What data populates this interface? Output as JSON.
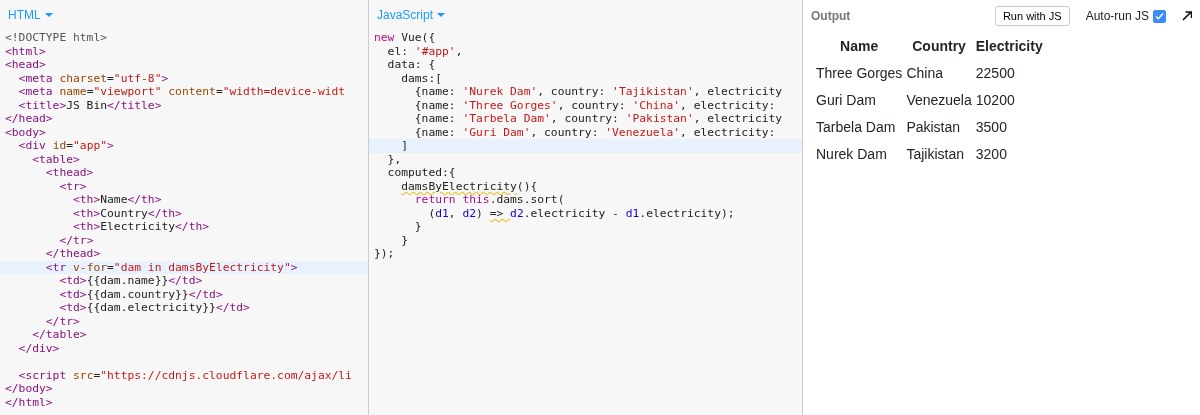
{
  "panels": [
    {
      "title": "HTML",
      "lines": [
        {
          "active": false,
          "tokens": [
            {
              "kind": "meta",
              "text": "<!DOCTYPE html>"
            }
          ]
        },
        {
          "active": false,
          "tokens": [
            {
              "kind": "tag",
              "text": "<html>"
            }
          ]
        },
        {
          "active": false,
          "tokens": [
            {
              "kind": "tag",
              "text": "<head>"
            }
          ]
        },
        {
          "active": false,
          "tokens": [
            {
              "kind": "tag",
              "text": "  <meta "
            },
            {
              "kind": "attr",
              "text": "charset"
            },
            {
              "kind": "plain",
              "text": "="
            },
            {
              "kind": "string",
              "text": "\"utf-8\""
            },
            {
              "kind": "tag",
              "text": ">"
            }
          ]
        },
        {
          "active": false,
          "tokens": [
            {
              "kind": "tag",
              "text": "  <meta "
            },
            {
              "kind": "attr",
              "text": "name"
            },
            {
              "kind": "plain",
              "text": "="
            },
            {
              "kind": "string",
              "text": "\"viewport\" "
            },
            {
              "kind": "attr",
              "text": "content"
            },
            {
              "kind": "plain",
              "text": "="
            },
            {
              "kind": "string",
              "text": "\"width=device-widt"
            }
          ]
        },
        {
          "active": false,
          "tokens": [
            {
              "kind": "tag",
              "text": "  <title>"
            },
            {
              "kind": "plain",
              "text": "JS Bin"
            },
            {
              "kind": "tag",
              "text": "</title>"
            }
          ]
        },
        {
          "active": false,
          "tokens": [
            {
              "kind": "tag",
              "text": "</head>"
            }
          ]
        },
        {
          "active": false,
          "tokens": [
            {
              "kind": "tag",
              "text": "<body>"
            }
          ]
        },
        {
          "active": false,
          "tokens": [
            {
              "kind": "tag",
              "text": "  <div "
            },
            {
              "kind": "attr",
              "text": "id"
            },
            {
              "kind": "plain",
              "text": "="
            },
            {
              "kind": "string",
              "text": "\"app\""
            },
            {
              "kind": "tag",
              "text": ">"
            }
          ]
        },
        {
          "active": false,
          "tokens": [
            {
              "kind": "tag",
              "text": "    <table>"
            }
          ]
        },
        {
          "active": false,
          "tokens": [
            {
              "kind": "tag",
              "text": "      <thead>"
            }
          ]
        },
        {
          "active": false,
          "tokens": [
            {
              "kind": "tag",
              "text": "        <tr>"
            }
          ]
        },
        {
          "active": false,
          "tokens": [
            {
              "kind": "tag",
              "text": "          <th>"
            },
            {
              "kind": "plain",
              "text": "Name"
            },
            {
              "kind": "tag",
              "text": "</th>"
            }
          ]
        },
        {
          "active": false,
          "tokens": [
            {
              "kind": "tag",
              "text": "          <th>"
            },
            {
              "kind": "plain",
              "text": "Country"
            },
            {
              "kind": "tag",
              "text": "</th>"
            }
          ]
        },
        {
          "active": false,
          "tokens": [
            {
              "kind": "tag",
              "text": "          <th>"
            },
            {
              "kind": "plain",
              "text": "Electricity"
            },
            {
              "kind": "tag",
              "text": "</th>"
            }
          ]
        },
        {
          "active": false,
          "tokens": [
            {
              "kind": "tag",
              "text": "        </tr>"
            }
          ]
        },
        {
          "active": false,
          "tokens": [
            {
              "kind": "tag",
              "text": "      </thead>"
            }
          ]
        },
        {
          "active": true,
          "tokens": [
            {
              "kind": "tag",
              "text": "      <tr "
            },
            {
              "kind": "attr",
              "text": "v-for"
            },
            {
              "kind": "plain",
              "text": "="
            },
            {
              "kind": "string",
              "text": "\"dam in damsByElectricity\""
            },
            {
              "kind": "tag",
              "text": ">"
            }
          ]
        },
        {
          "active": false,
          "tokens": [
            {
              "kind": "tag",
              "text": "        <td>"
            },
            {
              "kind": "plain",
              "text": "{{dam.name}}"
            },
            {
              "kind": "tag",
              "text": "</td>"
            }
          ]
        },
        {
          "active": false,
          "tokens": [
            {
              "kind": "tag",
              "text": "        <td>"
            },
            {
              "kind": "plain",
              "text": "{{dam.country}}"
            },
            {
              "kind": "tag",
              "text": "</td>"
            }
          ]
        },
        {
          "active": false,
          "tokens": [
            {
              "kind": "tag",
              "text": "        <td>"
            },
            {
              "kind": "plain",
              "text": "{{dam.electricity}}"
            },
            {
              "kind": "tag",
              "text": "</td>"
            }
          ]
        },
        {
          "active": false,
          "tokens": [
            {
              "kind": "tag",
              "text": "      </tr>"
            }
          ]
        },
        {
          "active": false,
          "tokens": [
            {
              "kind": "tag",
              "text": "    </table>"
            }
          ]
        },
        {
          "active": false,
          "tokens": [
            {
              "kind": "tag",
              "text": "  </div>"
            }
          ]
        },
        {
          "active": false
        },
        {
          "active": false,
          "tokens": [
            {
              "kind": "tag",
              "text": "  <script "
            },
            {
              "kind": "attr",
              "text": "src"
            },
            {
              "kind": "plain",
              "text": "="
            },
            {
              "kind": "string",
              "text": "\"https://cdnjs.cloudflare.com/ajax/li"
            }
          ]
        },
        {
          "active": false,
          "tokens": [
            {
              "kind": "tag",
              "text": "</body>"
            }
          ]
        },
        {
          "active": false,
          "tokens": [
            {
              "kind": "tag",
              "text": "</html>"
            }
          ]
        }
      ]
    },
    {
      "title": "JavaScript",
      "lines": [
        {
          "active": false,
          "tokens": [
            {
              "kind": "keyword",
              "text": "new"
            },
            {
              "kind": "plain",
              "text": " Vue({"
            }
          ]
        },
        {
          "active": false,
          "tokens": [
            {
              "kind": "plain",
              "text": "  el: "
            },
            {
              "kind": "string",
              "text": "'#app'"
            },
            {
              "kind": "plain",
              "text": ","
            }
          ]
        },
        {
          "active": false,
          "tokens": [
            {
              "kind": "plain",
              "text": "  data: {"
            }
          ]
        },
        {
          "active": false,
          "tokens": [
            {
              "kind": "plain",
              "text": "    dams:["
            }
          ]
        },
        {
          "active": false,
          "tokens": [
            {
              "kind": "plain",
              "text": "      {name: "
            },
            {
              "kind": "string",
              "text": "'Nurek Dam'"
            },
            {
              "kind": "plain",
              "text": ", country: "
            },
            {
              "kind": "string",
              "text": "'Tajikistan'"
            },
            {
              "kind": "plain",
              "text": ", electricity"
            }
          ]
        },
        {
          "active": false,
          "tokens": [
            {
              "kind": "plain",
              "text": "      {name: "
            },
            {
              "kind": "string",
              "text": "'Three Gorges'"
            },
            {
              "kind": "plain",
              "text": ", country: "
            },
            {
              "kind": "string",
              "text": "'China'"
            },
            {
              "kind": "plain",
              "text": ", electricity:"
            }
          ]
        },
        {
          "active": false,
          "tokens": [
            {
              "kind": "plain",
              "text": "      {name: "
            },
            {
              "kind": "string",
              "text": "'Tarbela Dam'"
            },
            {
              "kind": "plain",
              "text": ", country: "
            },
            {
              "kind": "string",
              "text": "'Pakistan'"
            },
            {
              "kind": "plain",
              "text": ", electricity"
            }
          ]
        },
        {
          "active": false,
          "tokens": [
            {
              "kind": "plain",
              "text": "      {name: "
            },
            {
              "kind": "string",
              "text": "'Guri Dam'"
            },
            {
              "kind": "plain",
              "text": ", country: "
            },
            {
              "kind": "string",
              "text": "'Venezuela'"
            },
            {
              "kind": "plain",
              "text": ", electricity:"
            }
          ]
        },
        {
          "active": true,
          "tokens": [
            {
              "kind": "plain",
              "text": "    ]"
            }
          ]
        },
        {
          "active": false,
          "tokens": [
            {
              "kind": "plain",
              "text": "  },"
            }
          ]
        },
        {
          "active": false,
          "tokens": [
            {
              "kind": "plain",
              "text": "  computed:{"
            }
          ]
        },
        {
          "active": false,
          "tokens": [
            {
              "kind": "warning",
              "text": "    damsByElectricity"
            },
            {
              "kind": "plain",
              "text": "(){"
            }
          ]
        },
        {
          "active": false,
          "tokens": [
            {
              "kind": "keyword",
              "text": "      return this"
            },
            {
              "kind": "plain",
              "text": ".dams.sort("
            }
          ]
        },
        {
          "active": false,
          "tokens": [
            {
              "kind": "plain",
              "text": "        ("
            },
            {
              "kind": "variable",
              "text": "d1"
            },
            {
              "kind": "plain",
              "text": ", "
            },
            {
              "kind": "variable",
              "text": "d2"
            },
            {
              "kind": "plain",
              "text": ") "
            },
            {
              "kind": "warning",
              "text": "=> "
            },
            {
              "kind": "variable",
              "text": "d2"
            },
            {
              "kind": "plain",
              "text": ".electricity - "
            },
            {
              "kind": "variable",
              "text": "d1"
            },
            {
              "kind": "plain",
              "text": ".electricity);"
            }
          ]
        },
        {
          "active": false,
          "tokens": [
            {
              "kind": "plain",
              "text": "      }"
            }
          ]
        },
        {
          "active": false,
          "tokens": [
            {
              "kind": "plain",
              "text": "    }"
            }
          ]
        },
        {
          "active": false,
          "tokens": [
            {
              "kind": "plain",
              "text": "});"
            }
          ]
        }
      ]
    }
  ],
  "output": {
    "title": "Output",
    "run_button": "Run with JS",
    "auto_run": {
      "label": "Auto-run JS",
      "checked": true
    },
    "table": {
      "columns": [
        "Name",
        "Country",
        "Electricity"
      ],
      "rows": [
        [
          "Three Gorges",
          "China",
          "22500"
        ],
        [
          "Guri Dam",
          "Venezuela",
          "10200"
        ],
        [
          "Tarbela Dam",
          "Pakistan",
          "3500"
        ],
        [
          "Nurek Dam",
          "Tajikistan",
          "3200"
        ]
      ]
    }
  }
}
